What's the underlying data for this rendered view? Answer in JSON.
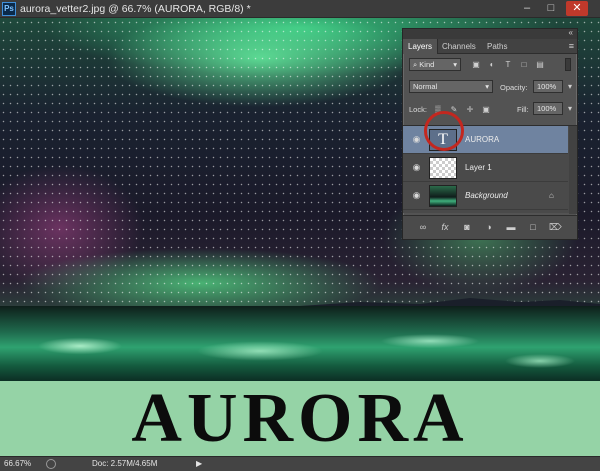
{
  "window": {
    "app_icon": "Ps",
    "title": "aurora_vetter2.jpg @ 66.7% (AURORA, RGB/8) *",
    "controls": {
      "minimize": "‒",
      "maximize": "□",
      "close": "✕"
    }
  },
  "canvas": {
    "text_layer": "AURORA"
  },
  "layers_panel": {
    "collapse_glyph": "«",
    "tabs": [
      {
        "label": "Layers",
        "active": true
      },
      {
        "label": "Channels",
        "active": false
      },
      {
        "label": "Paths",
        "active": false
      }
    ],
    "menu_glyph": "≡",
    "filter": {
      "kind_label": "Kind",
      "icons": [
        "image-filter-icon",
        "adjustment-filter-icon",
        "type-filter-icon",
        "shape-filter-icon",
        "smart-object-filter-icon"
      ]
    },
    "blend_mode": "Normal",
    "opacity_label": "Opacity:",
    "opacity_value": "100%",
    "lock_label": "Lock:",
    "fill_label": "Fill:",
    "fill_value": "100%",
    "layers": [
      {
        "name": "AURORA",
        "type": "text",
        "thumb_glyph": "T",
        "selected": true,
        "visible": true,
        "locked": false
      },
      {
        "name": "Layer 1",
        "type": "pixel",
        "selected": false,
        "visible": true,
        "locked": false
      },
      {
        "name": "Background",
        "type": "background",
        "selected": false,
        "visible": true,
        "locked": true
      }
    ],
    "footer_icons": [
      "link-icon",
      "fx-icon",
      "mask-icon",
      "adjustment-icon",
      "group-icon",
      "new-layer-icon",
      "trash-icon"
    ]
  },
  "status_bar": {
    "zoom": "66.67%",
    "doc_info": "Doc: 2.57M/4.65M",
    "arrow": "▶"
  },
  "colors": {
    "selected_layer": "#6f83a0",
    "highlight_ring": "#c3271f",
    "text_band": "#95d3a6"
  }
}
